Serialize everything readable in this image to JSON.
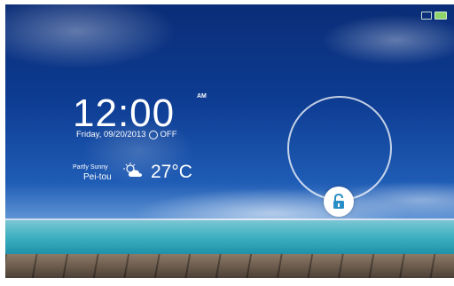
{
  "lockscreen": {
    "time": "12:00",
    "ampm": "AM",
    "date": "Friday, 09/20/2013",
    "alarm_status": "OFF",
    "weather": {
      "condition": "Partly Sunny",
      "city": "Pei-tou",
      "temperature": "27°C",
      "icon": "partly-sunny-icon"
    },
    "unlock_icon": "unlock-icon"
  },
  "status_bar": {
    "icons": [
      "wifi-icon",
      "battery-icon"
    ]
  },
  "colors": {
    "sky_top": "#0b2d77",
    "sea": "#3fb2c2",
    "unlock_accent": "#2a8fc6"
  }
}
